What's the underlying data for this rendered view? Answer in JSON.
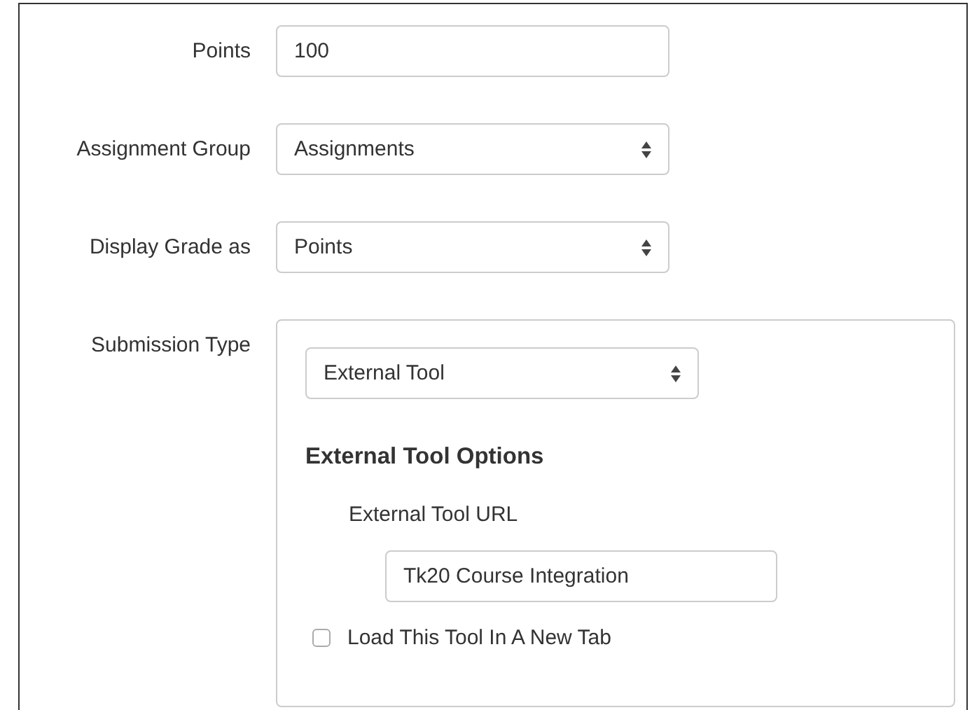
{
  "fields": [
    {
      "label": "Points",
      "kind": "text",
      "value": "100"
    },
    {
      "label": "Assignment Group",
      "kind": "select",
      "value": "Assignments"
    },
    {
      "label": "Display Grade as",
      "kind": "select",
      "value": "Points"
    }
  ],
  "submission_type": {
    "label": "Submission Type",
    "value": "External Tool",
    "options_heading": "External Tool Options",
    "url_label": "External Tool URL",
    "url_value": "Tk20 Course Integration",
    "new_tab": {
      "label": "Load This Tool In A New Tab",
      "checked": false
    }
  }
}
